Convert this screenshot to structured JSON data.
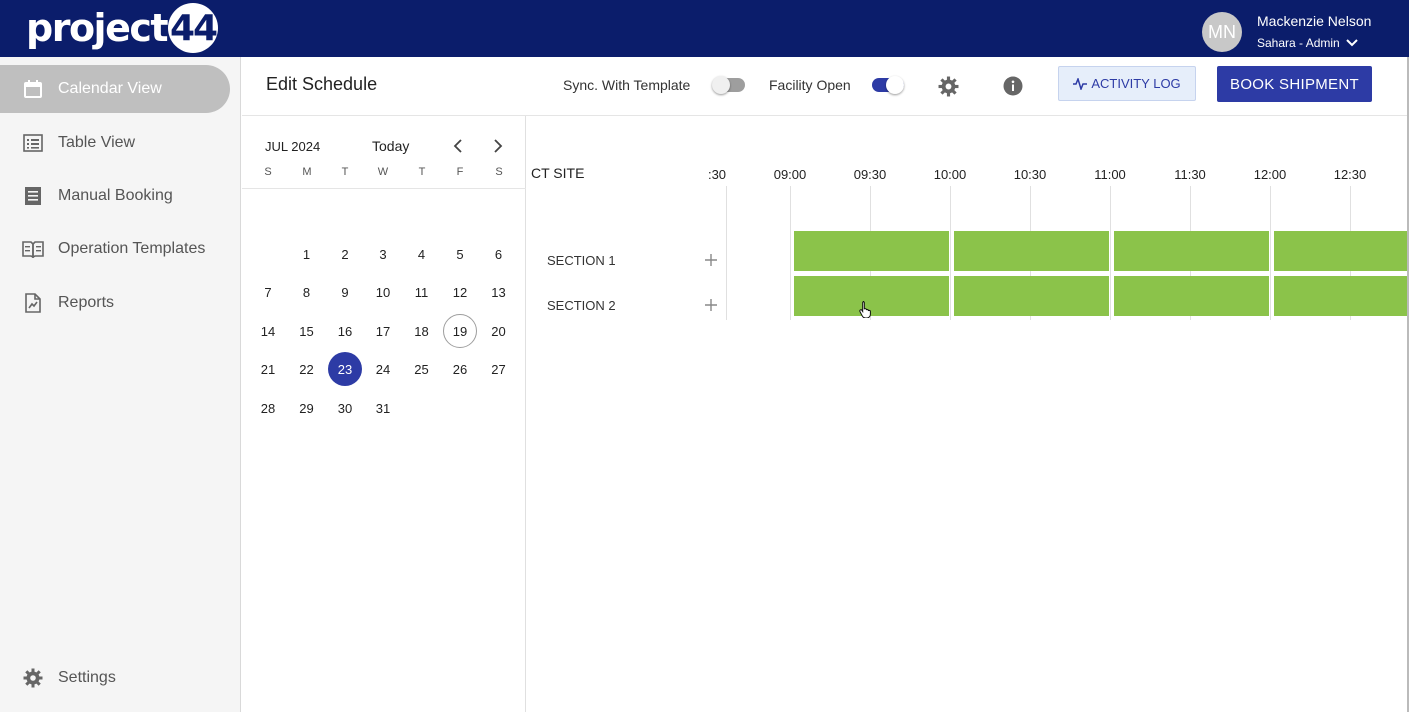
{
  "app": {
    "logo_text": "project",
    "logo_number": "44"
  },
  "user": {
    "initials": "MN",
    "name": "Mackenzie Nelson",
    "org": "Sahara - Admin"
  },
  "sidebar": {
    "items": [
      {
        "label": "Calendar View",
        "icon": "calendar-icon",
        "active": true
      },
      {
        "label": "Table View",
        "icon": "list-icon"
      },
      {
        "label": "Manual Booking",
        "icon": "document-icon"
      },
      {
        "label": "Operation Templates",
        "icon": "book-icon"
      },
      {
        "label": "Reports",
        "icon": "report-icon"
      }
    ],
    "settings_label": "Settings"
  },
  "header": {
    "title": "Edit Schedule",
    "sync_label": "Sync. With Template",
    "sync_on": false,
    "facility_label": "Facility Open",
    "facility_on": true,
    "activity_log_label": "ACTIVITY LOG",
    "book_label": "BOOK SHIPMENT"
  },
  "calendar": {
    "month_label": "JUL 2024",
    "today_label": "Today",
    "weekdays": [
      "S",
      "M",
      "T",
      "W",
      "T",
      "F",
      "S"
    ],
    "today_day": 19,
    "selected_day": 23,
    "days": [
      "1",
      "2",
      "3",
      "4",
      "5",
      "6",
      "7",
      "8",
      "9",
      "10",
      "11",
      "12",
      "13",
      "14",
      "15",
      "16",
      "17",
      "18",
      "19",
      "20",
      "21",
      "22",
      "23",
      "24",
      "25",
      "26",
      "27",
      "28",
      "29",
      "30",
      "31"
    ]
  },
  "schedule": {
    "site_label": "CT SITE",
    "partial_time_label": ":30",
    "time_labels": [
      "09:00",
      "09:30",
      "10:00",
      "10:30",
      "11:00",
      "11:30",
      "12:00",
      "12:30"
    ],
    "sections": [
      "SECTION 1",
      "SECTION 2"
    ],
    "slot_color": "#8bc34a"
  },
  "colors": {
    "topbar": "#0b1d6b",
    "primary": "#2d3ba5"
  }
}
